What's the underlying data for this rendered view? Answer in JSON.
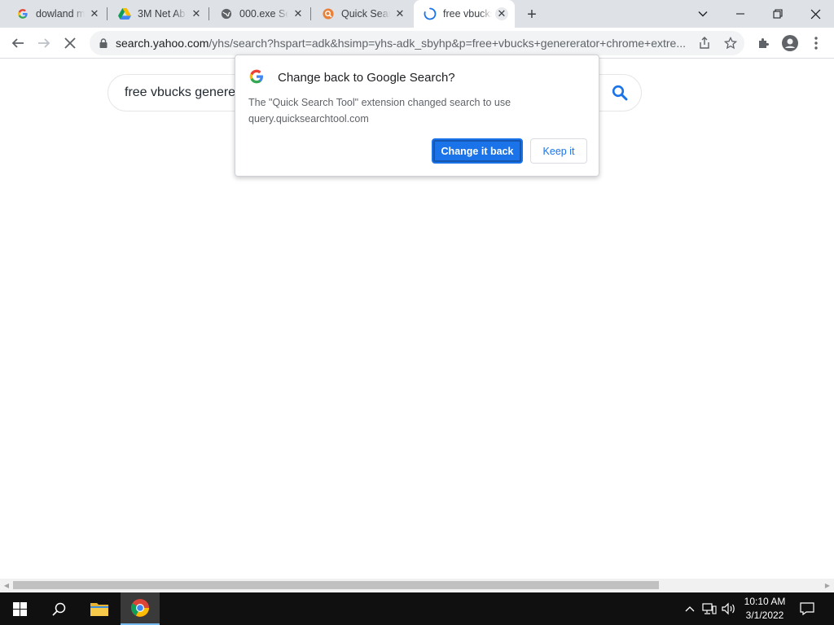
{
  "tabs": [
    {
      "title": "dowland m",
      "favicon": "google-icon"
    },
    {
      "title": "3M Net Ab",
      "favicon": "google-drive-icon"
    },
    {
      "title": "000.exe Se",
      "favicon": "globe-icon"
    },
    {
      "title": "Quick Searc",
      "favicon": "quick-search-icon"
    },
    {
      "title": "free vbucks",
      "favicon": "loading-spinner-icon"
    }
  ],
  "address": {
    "host": "search.yahoo.com",
    "path": "/yhs/search?hspart=adk&hsimp=yhs-adk_sbyhp&p=free+vbucks+genererator+chrome+extre..."
  },
  "search": {
    "query": "free vbucks genere"
  },
  "popup": {
    "title": "Change back to Google Search?",
    "body": "The \"Quick Search Tool\" extension changed search to use query.quicksearchtool.com",
    "primary_button": "Change it back",
    "secondary_button": "Keep it"
  },
  "taskbar": {
    "time": "10:10 AM",
    "date": "3/1/2022"
  },
  "colors": {
    "accent": "#1a73e8",
    "tabstrip": "#dee1e6",
    "taskbar": "#101010"
  }
}
